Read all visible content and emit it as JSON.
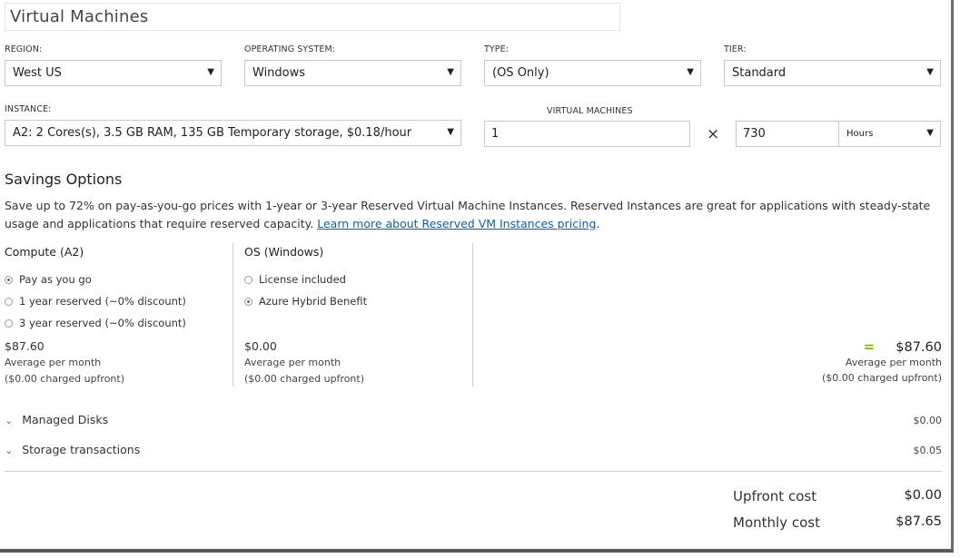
{
  "title": "Virtual Machines",
  "fields": {
    "region": {
      "label": "REGION:",
      "value": "West US"
    },
    "os": {
      "label": "OPERATING SYSTEM:",
      "value": "Windows"
    },
    "type": {
      "label": "TYPE:",
      "value": "(OS Only)"
    },
    "tier": {
      "label": "TIER:",
      "value": "Standard"
    },
    "instance": {
      "label": "INSTANCE:",
      "value": "A2: 2 Cores(s), 3.5 GB RAM, 135 GB Temporary storage, $0.18/hour"
    },
    "vms": {
      "label": "VIRTUAL MACHINES",
      "value": "1"
    },
    "multiply": "×",
    "hours": {
      "value": "730",
      "unit": "Hours"
    }
  },
  "savings": {
    "heading": "Savings Options",
    "text": "Save up to 72% on pay-as-you-go prices with 1-year or 3-year Reserved Virtual Machine Instances. Reserved Instances are great for applications with steady-state usage and applications that require reserved capacity.",
    "link": "Learn more about Reserved VM Instances pricing",
    "after_link": "."
  },
  "compute": {
    "heading": "Compute (A2)",
    "options": [
      {
        "label": "Pay as you go",
        "selected": true
      },
      {
        "label": "1 year reserved (~0% discount)",
        "selected": false
      },
      {
        "label": "3 year reserved (~0% discount)",
        "selected": false
      }
    ],
    "price": "$87.60",
    "sub1": "Average per month",
    "sub2": "($0.00 charged upfront)"
  },
  "os_section": {
    "heading": "OS (Windows)",
    "options": [
      {
        "label": "License included",
        "selected": false
      },
      {
        "label": "Azure Hybrid Benefit",
        "selected": true
      }
    ],
    "price": "$0.00",
    "sub1": "Average per month",
    "sub2": "($0.00 charged upfront)"
  },
  "total": {
    "eq": "=",
    "price": "$87.60",
    "sub1": "Average per month",
    "sub2": "($0.00 charged upfront)"
  },
  "rows": [
    {
      "label": "Managed Disks",
      "value": "$0.00"
    },
    {
      "label": "Storage transactions",
      "value": "$0.05"
    }
  ],
  "summary": {
    "upfront_label": "Upfront cost",
    "upfront_value": "$0.00",
    "monthly_label": "Monthly cost",
    "monthly_value": "$87.65"
  },
  "icons": {
    "caret": "▼",
    "chevron": "⌄"
  },
  "colors": {
    "link": "#0f5fa6",
    "equals": "#7fba00",
    "chevron": "#3a7bbf"
  }
}
